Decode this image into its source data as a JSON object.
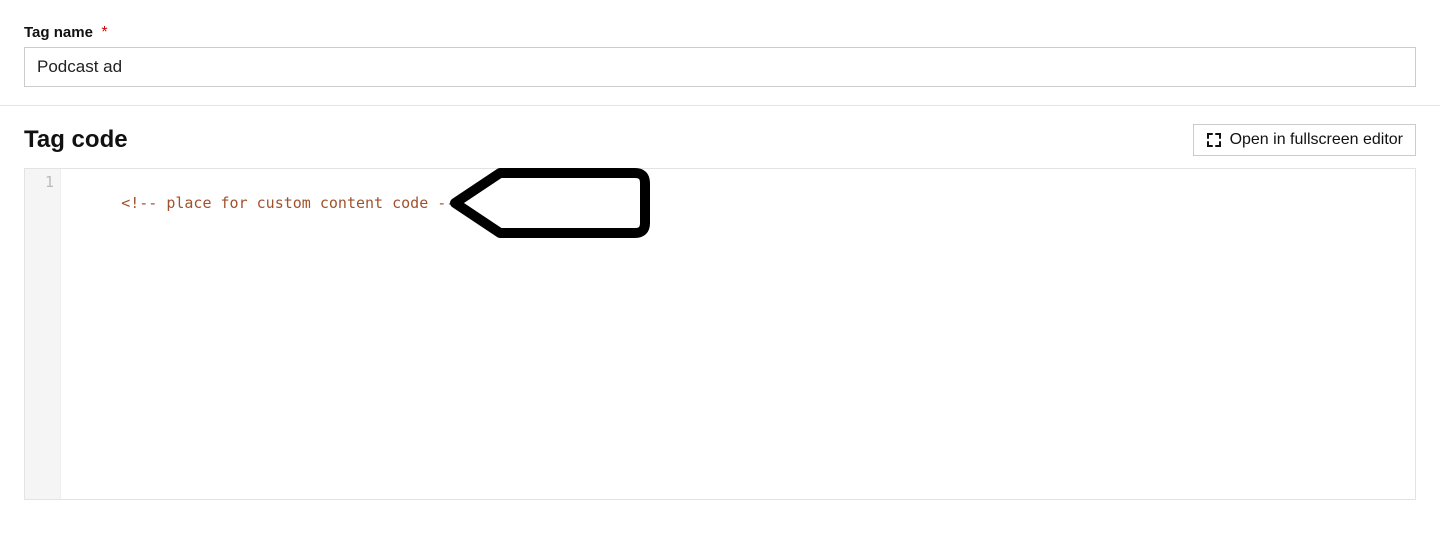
{
  "form": {
    "tagName": {
      "label": "Tag name",
      "required_mark": "*",
      "value": "Podcast ad"
    }
  },
  "codeSection": {
    "title": "Tag code",
    "fullscreenButton": "Open in fullscreen editor",
    "editor": {
      "lineNumber": "1",
      "line1": "<!-- place for custom content code -->"
    }
  }
}
